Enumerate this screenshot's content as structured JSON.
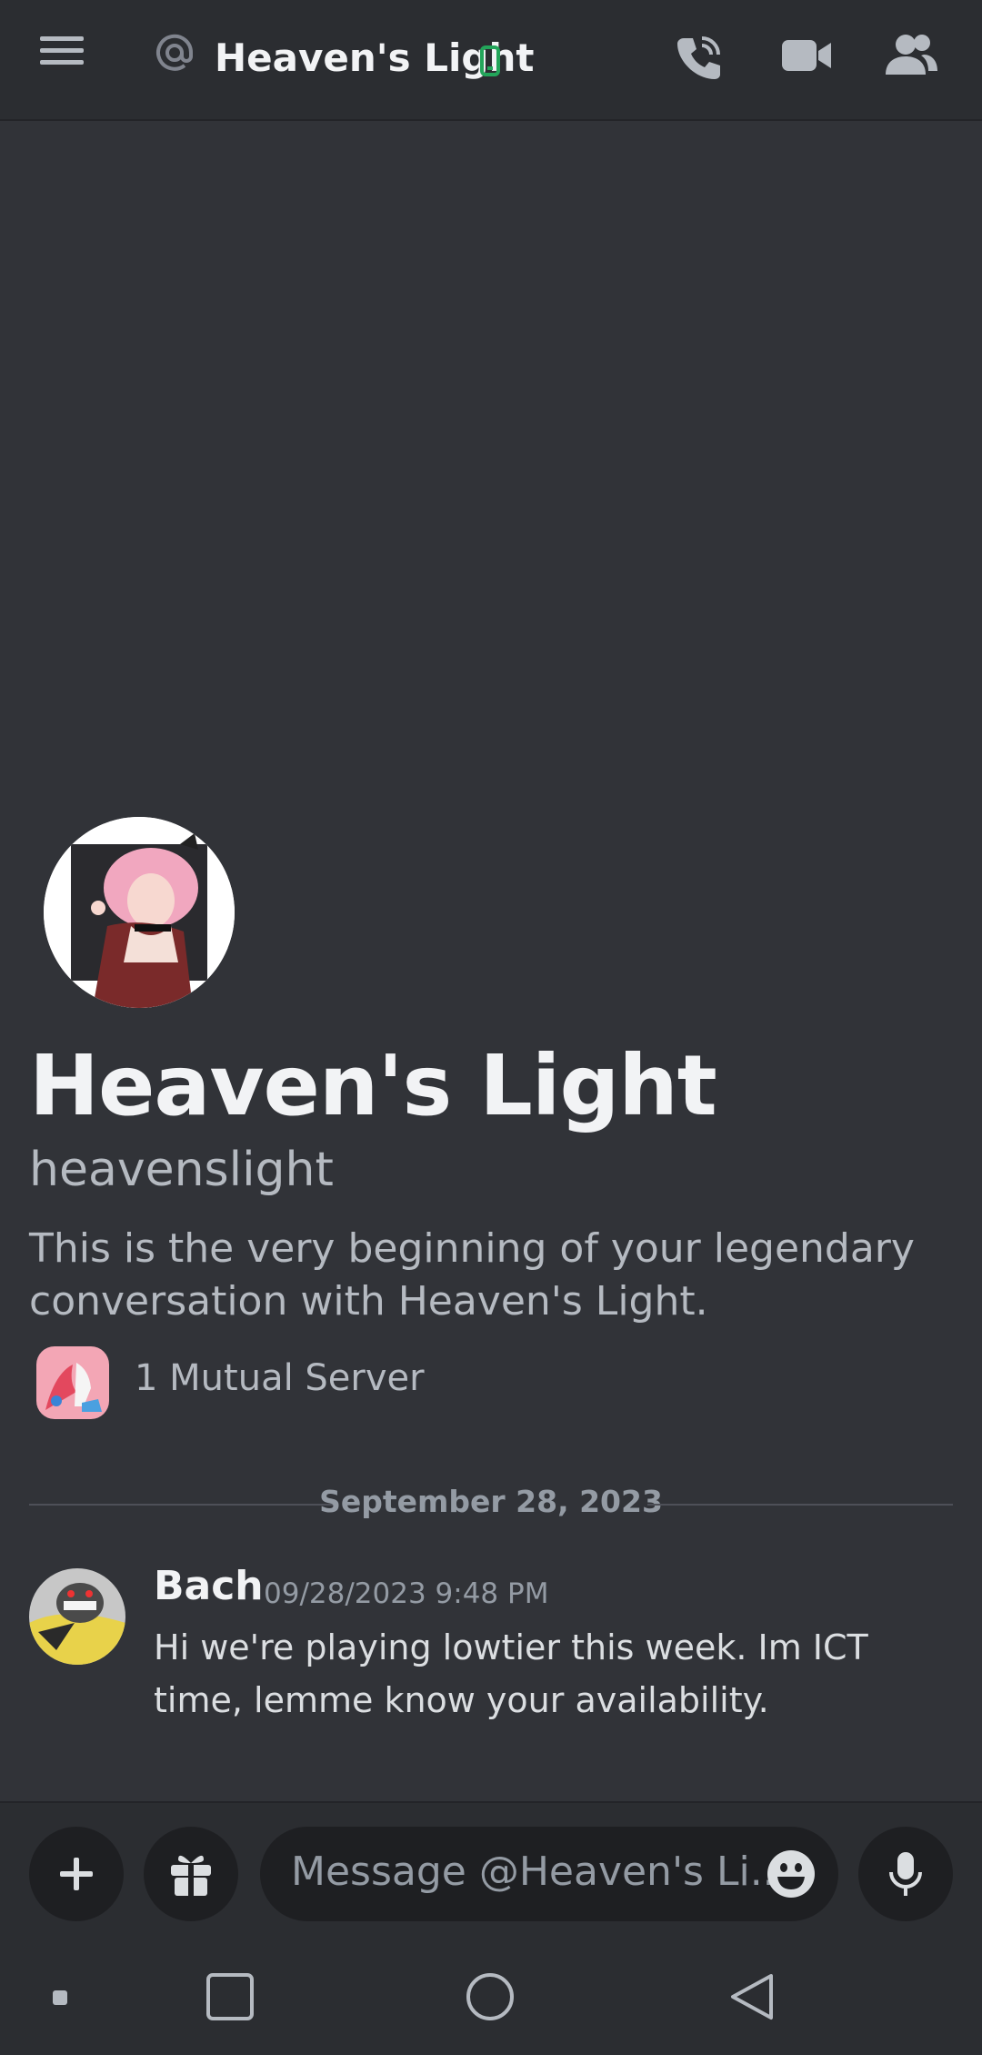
{
  "header": {
    "title": "Heaven's Light",
    "icons": {
      "menu": "hamburger-menu-icon",
      "at": "at-sign-icon",
      "status": "mobile-online-icon",
      "call": "phone-call-icon",
      "video": "video-camera-icon",
      "members": "members-icon"
    },
    "status_color": "#23a55a"
  },
  "profile": {
    "display_name": "Heaven's Light",
    "username": "heavenslight",
    "intro": "This is the very beginning of your legendary conversation with Heaven's Light.",
    "mutual_servers": "1 Mutual Server"
  },
  "divider": {
    "date": "September 28, 2023"
  },
  "messages": [
    {
      "author": "Bach",
      "timestamp": "09/28/2023 9:48 PM",
      "text": "Hi we're playing lowtier this week. Im ICT time, lemme know your availability."
    }
  ],
  "composer": {
    "placeholder": "Message @Heaven's Li...",
    "icons": [
      "plus-icon",
      "gift-icon",
      "emoji-icon",
      "microphone-icon"
    ]
  },
  "system_nav": {
    "icons": [
      "menu-dot-icon",
      "recents-square-icon",
      "home-circle-icon",
      "back-triangle-icon"
    ]
  },
  "colors": {
    "background": "#313338",
    "header": "#2b2d31",
    "input": "#1e1f22",
    "text_primary": "#f2f3f5",
    "text_muted": "#b5bac1"
  }
}
